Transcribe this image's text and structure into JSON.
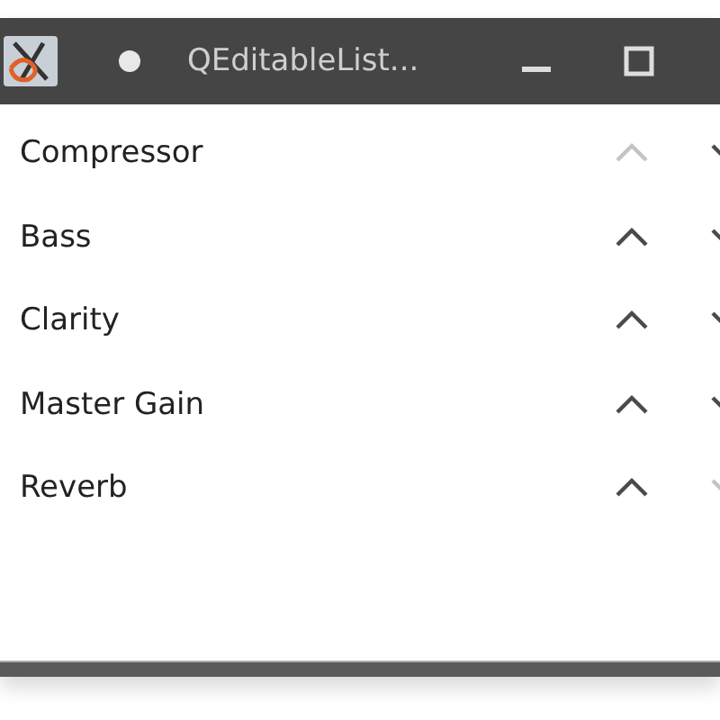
{
  "window": {
    "title": "QEditableList..."
  },
  "items": [
    {
      "label": "Compressor",
      "up_disabled": true,
      "down_disabled": false
    },
    {
      "label": "Bass",
      "up_disabled": false,
      "down_disabled": false
    },
    {
      "label": "Clarity",
      "up_disabled": false,
      "down_disabled": false
    },
    {
      "label": "Master Gain",
      "up_disabled": false,
      "down_disabled": false
    },
    {
      "label": "Reverb",
      "up_disabled": false,
      "down_disabled": true
    }
  ]
}
